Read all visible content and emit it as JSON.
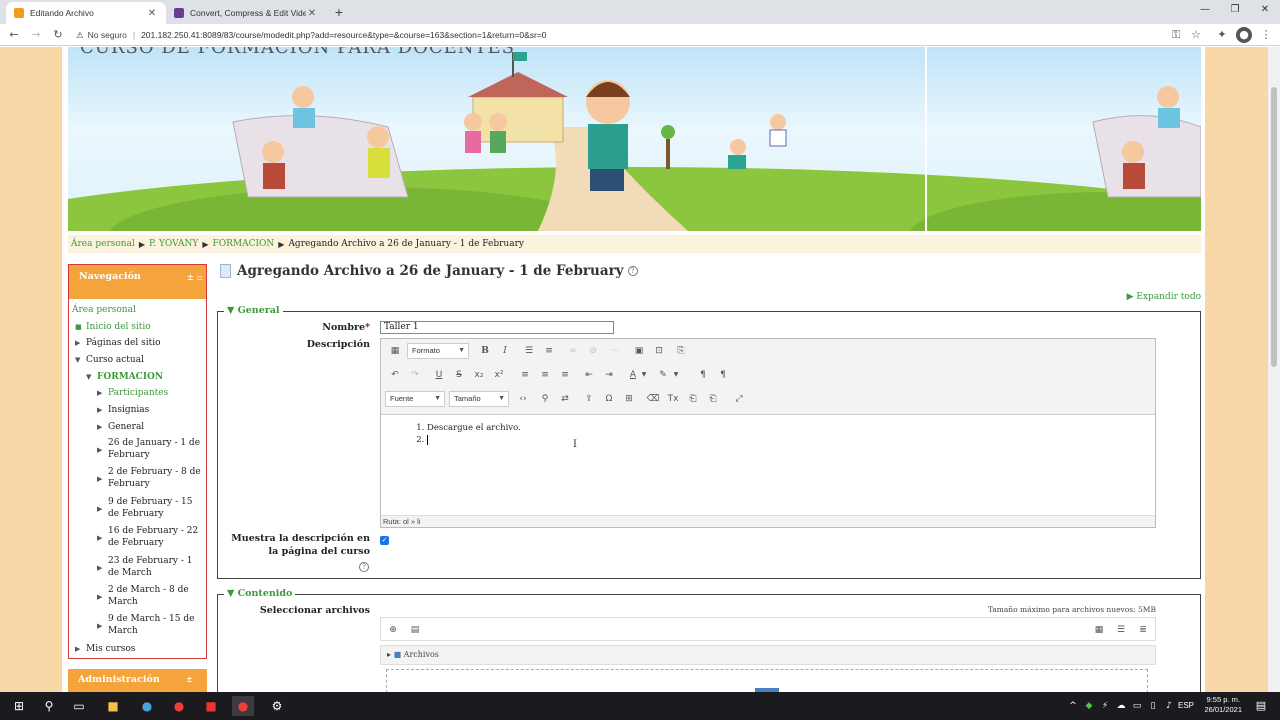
{
  "browser": {
    "tabs": [
      {
        "title": "Editando Archivo",
        "active": true
      },
      {
        "title": "Convert, Compress & Edit Video",
        "active": false
      }
    ],
    "security_label": "No seguro",
    "url": "201.182.250.41:8089/83/course/modedit.php?add=resource&type=&course=163&section=1&return=0&sr=0"
  },
  "banner": {
    "title": "CURSO DE FORMACION PARA DOCENTES"
  },
  "breadcrumb": [
    "Área personal",
    "P. YOVANY",
    "FORMACION",
    "Agregando Archivo a 26 de January - 1 de February"
  ],
  "nav": {
    "header": "Navegación",
    "area_personal": "Área personal",
    "inicio": "Inicio del sitio",
    "paginas": "Páginas del sitio",
    "curso_actual": "Curso actual",
    "formacion": "FORMACION",
    "participantes": "Participantes",
    "insignias": "Insignias",
    "general": "General",
    "weeks": [
      "26 de January - 1 de February",
      "2 de February - 8 de February",
      "9 de February - 15 de February",
      "16 de February - 22 de February",
      "23 de February - 1 de March",
      "2 de March - 8 de March",
      "9 de March - 15 de March"
    ],
    "mis_cursos": "Mis cursos",
    "admin_header": "Administración"
  },
  "main": {
    "heading": "Agregando Archivo a 26 de January - 1 de February",
    "expand_all": "Expandir todo",
    "general_legend": "General",
    "nombre_label": "Nombre",
    "nombre_value": "Taller 1",
    "descripcion_label": "Descripción",
    "editor": {
      "formato": "Formato",
      "fuente": "Fuente",
      "tamano": "Tamaño",
      "item1": "Descargue el archivo.",
      "path": "Ruta: ol » li"
    },
    "show_desc_label": "Muestra la descripción en la página del curso",
    "contenido_legend": "Contenido",
    "select_files_label": "Seleccionar archivos",
    "max_size": "Tamaño máximo para archivos nuevos: 5MB",
    "archivos": "Archivos"
  },
  "taskbar": {
    "lang": "ESP",
    "time": "9:55 p. m.",
    "date": "26/01/2021"
  }
}
